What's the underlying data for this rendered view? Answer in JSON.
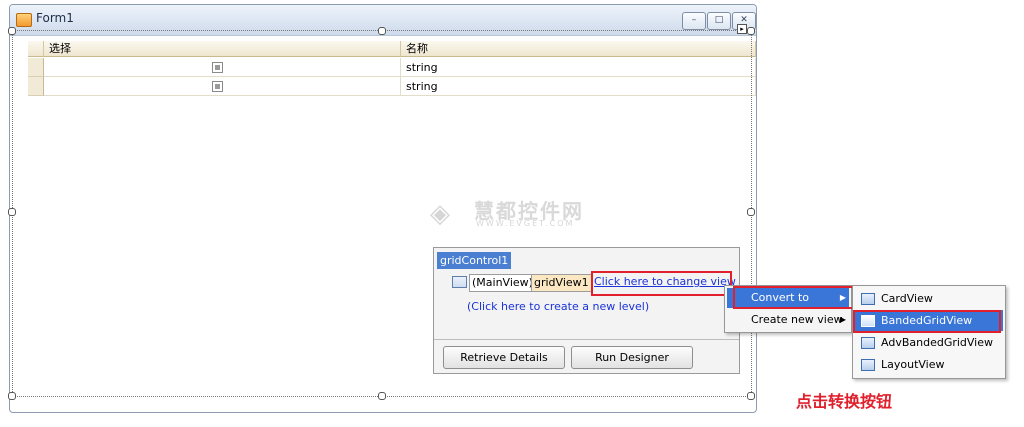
{
  "form": {
    "title": "Form1",
    "minimize_glyph": "–",
    "maximize_glyph": "□",
    "close_glyph": "✕"
  },
  "grid": {
    "columns": [
      "选择",
      "名称"
    ],
    "rows": [
      {
        "checked": false,
        "name": "string"
      },
      {
        "checked": false,
        "name": "string"
      }
    ]
  },
  "watermark": {
    "cn": "慧都控件网",
    "en": "WWW.EVGET.COM"
  },
  "designer_panel": {
    "title": "gridControl1",
    "main_view_label": "(MainView)",
    "grid_view_label": "gridView1",
    "change_view_link": "Click here to change view",
    "new_level_link": "(Click here to create a new level)",
    "buttons": [
      "Retrieve Details",
      "Run Designer"
    ]
  },
  "context_menu": {
    "items": [
      {
        "label": "Convert to",
        "has_submenu": true,
        "selected": true
      },
      {
        "label": "Create new view",
        "has_submenu": true,
        "selected": false
      }
    ]
  },
  "submenu": {
    "items": [
      {
        "label": "CardView",
        "icon": "card-view-icon",
        "selected": false
      },
      {
        "label": "BandedGridView",
        "icon": "banded-grid-view-icon",
        "selected": true
      },
      {
        "label": "AdvBandedGridView",
        "icon": "adv-banded-grid-view-icon",
        "selected": false
      },
      {
        "label": "LayoutView",
        "icon": "layout-view-icon",
        "selected": false
      }
    ]
  },
  "caption": "点击转换按钮",
  "colors": {
    "highlight": "#3a76d8",
    "annotation_red": "#e0202c",
    "link": "#1a33d6"
  }
}
